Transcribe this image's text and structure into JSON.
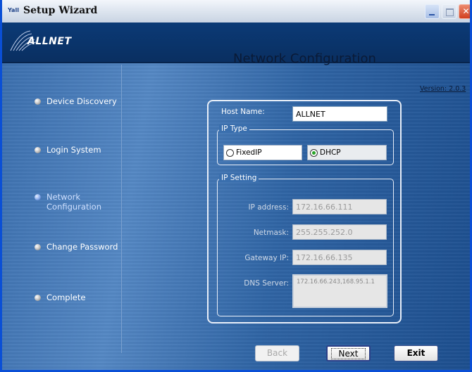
{
  "window": {
    "title": "Setup Wizard",
    "app_icon_text": "Yall"
  },
  "logo": {
    "text": "ALLNET"
  },
  "steps": [
    {
      "label": "Device Discovery",
      "active": false
    },
    {
      "label": "Login System",
      "active": false
    },
    {
      "label": "Network Configuration",
      "active": true
    },
    {
      "label": "Change Password",
      "active": false
    },
    {
      "label": "Complete",
      "active": false
    }
  ],
  "main": {
    "title": "Network Configuration",
    "version": "Version: 2.0.3"
  },
  "form": {
    "host_name_label": "Host Name:",
    "host_name_value": "ALLNET",
    "ip_type_title": "IP Type",
    "ip_type_options": [
      {
        "label": "FixedIP",
        "selected": false
      },
      {
        "label": "DHCP",
        "selected": true
      }
    ],
    "ip_setting_title": "IP Setting",
    "ip_address_label": "IP address:",
    "ip_address_value": "172.16.66.111",
    "netmask_label": "Netmask:",
    "netmask_value": "255.255.252.0",
    "gateway_label": "Gateway IP:",
    "gateway_value": "172.16.66.135",
    "dns_label": "DNS Server:",
    "dns_value": "172.16.66.243,168.95.1.1"
  },
  "buttons": {
    "back": "Back",
    "next": "Next",
    "exit": "Exit"
  },
  "colors": {
    "title_bar_border": "#0a4fd6",
    "client_bg": "#3b6fae",
    "close_button": "#d2401f"
  }
}
